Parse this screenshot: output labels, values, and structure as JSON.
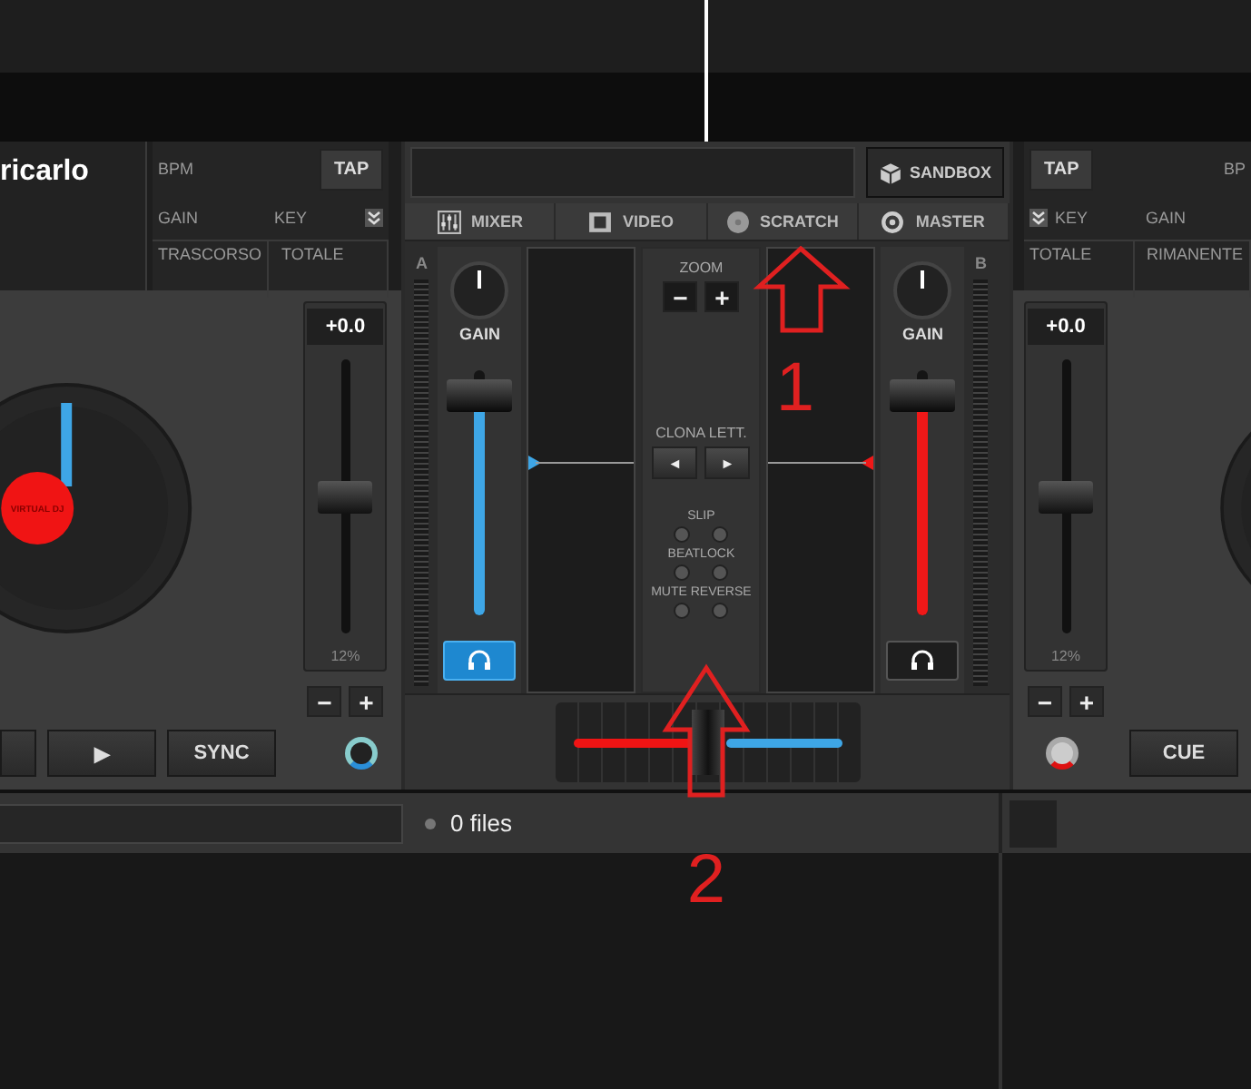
{
  "deck_left": {
    "title": "ricarlo",
    "bpm": "BPM",
    "tap": "TAP",
    "gain": "GAIN",
    "key": "KEY",
    "elapsed": "TRASCORSO",
    "total": "TOTALE",
    "logo": "VIRTUAL DJ",
    "pitch": {
      "value": "+0.0",
      "range": "12%",
      "level": 0.5
    },
    "minus": "−",
    "plus": "+",
    "buttons": [
      {
        "kind": "cut"
      },
      {
        "label": "▶",
        "kind": "play"
      },
      {
        "label": "SYNC",
        "kind": "text"
      }
    ]
  },
  "mixer": {
    "sandbox": "SANDBOX",
    "tabs": [
      {
        "label": "MIXER",
        "selected": false
      },
      {
        "label": "VIDEO",
        "selected": false
      },
      {
        "label": "SCRATCH",
        "selected": false
      },
      {
        "label": "MASTER",
        "selected": false
      }
    ],
    "channels": [
      {
        "letter": "A",
        "gain": "GAIN",
        "level": 0.9,
        "color": "#3ea6e6",
        "headphones_on": true
      },
      {
        "letter": "B",
        "gain": "GAIN",
        "level": 0.9,
        "color": "#f01818",
        "headphones_on": false
      }
    ],
    "zoom": "ZOOM",
    "zoom_minus": "−",
    "zoom_plus": "+",
    "clone": "CLONA LETT.",
    "clone_left": "◄",
    "clone_right": "►",
    "toggles": [
      {
        "label": "SLIP"
      },
      {
        "label": "BEATLOCK"
      },
      {
        "label": "MUTE REVERSE"
      }
    ],
    "crossfader": {
      "level": 0.5
    }
  },
  "deck_right": {
    "tap": "TAP",
    "key": "KEY",
    "gain": "GAIN",
    "bpm": "BP",
    "total": "TOTALE",
    "remaining": "RIMANENTE",
    "pitch": {
      "value": "+0.0",
      "range": "12%",
      "level": 0.5
    },
    "minus": "−",
    "plus": "+",
    "cue": "CUE"
  },
  "browser": {
    "file_count": "0 files"
  },
  "annotations": [
    {
      "number": "1"
    },
    {
      "number": "2"
    }
  ]
}
